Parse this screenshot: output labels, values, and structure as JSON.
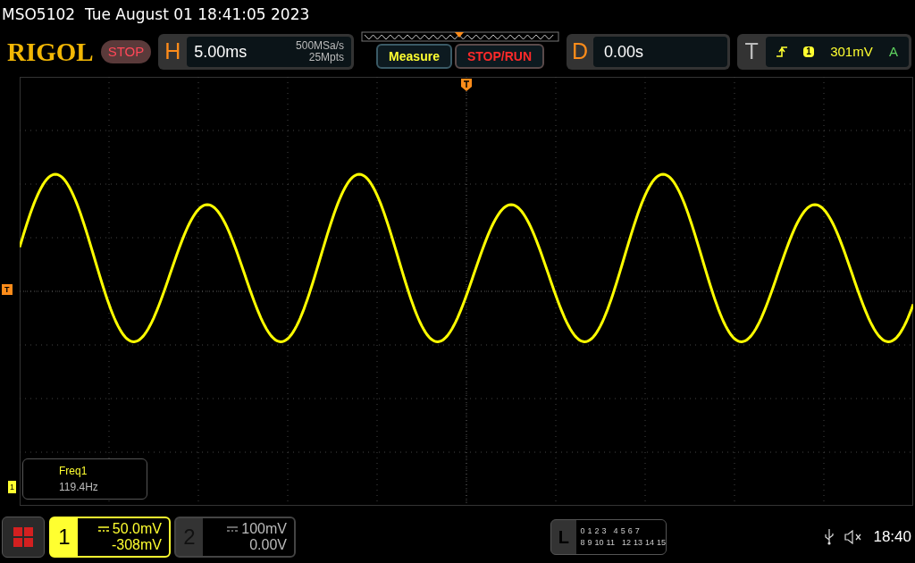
{
  "status_line": "MSO5102  Tue August 01 18:41:05 2023",
  "header": {
    "logo": "RIGOL",
    "run_state": "STOP",
    "horizontal": {
      "letter": "H",
      "scale": "5.00ms",
      "sample_rate": "500MSa/s",
      "memory_depth": "25Mpts"
    },
    "buttons": [
      {
        "label": "Measure",
        "kind": "measure"
      },
      {
        "label": "STOP/RUN",
        "kind": "stoprun"
      }
    ],
    "delay": {
      "letter": "D",
      "value": "0.00s"
    },
    "trigger": {
      "letter": "T",
      "source": "1",
      "level": "301mV",
      "mode": "A"
    }
  },
  "graticule": {
    "trigger_marker": "T",
    "channel_marker": "1"
  },
  "measurement": {
    "name": "Freq1",
    "value": "119.4Hz"
  },
  "channels": [
    {
      "number": "1",
      "scale": "50.0mV",
      "offset": "-308mV",
      "selected": true
    },
    {
      "number": "2",
      "scale": "100mV",
      "offset": "0.00V",
      "selected": false
    }
  ],
  "logic": {
    "letter": "L",
    "row_1": [
      "0",
      "1",
      "2",
      "3",
      "4",
      "5",
      "6",
      "7"
    ],
    "row_2": [
      "8",
      "9",
      "10",
      "11",
      "12",
      "13",
      "14",
      "15"
    ]
  },
  "clock": "18:40"
}
